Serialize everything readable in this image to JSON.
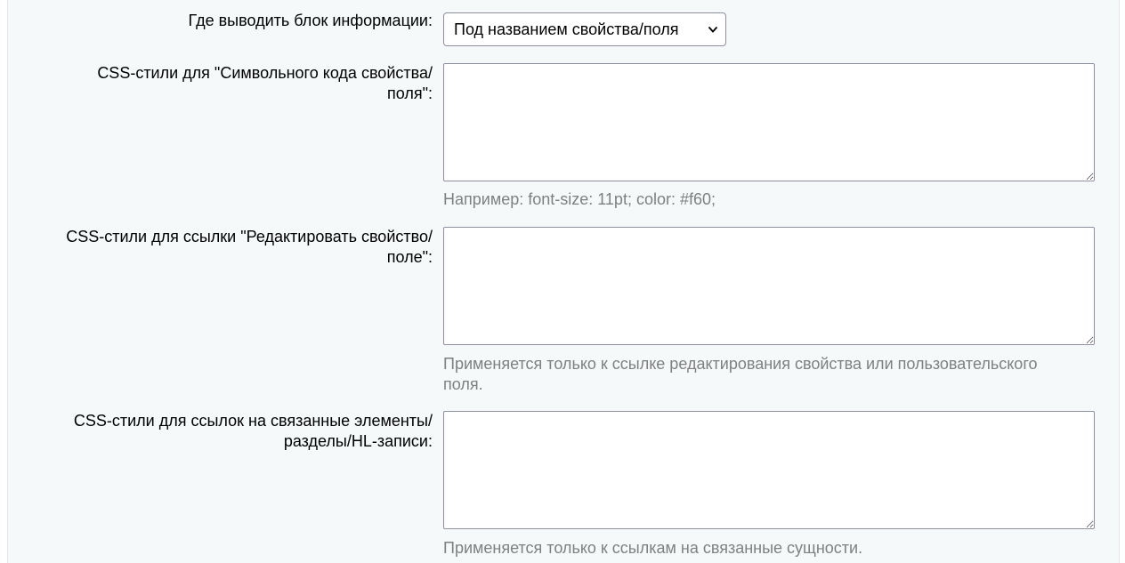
{
  "fields": {
    "info_block": {
      "label": "Где выводить блок информации:",
      "selected": "Под названием свойства/поля"
    },
    "code_css": {
      "label_line1": "CSS-стили для \"Символьного кода свойства/",
      "label_line2": "поля\":",
      "value": "",
      "hint": "Например: font-size: 11pt; color: #f60;"
    },
    "edit_link_css": {
      "label_line1": "CSS-стили для ссылки \"Редактировать свойство/",
      "label_line2": "поле\":",
      "value": "",
      "hint_line1": "Применяется только к ссылке редактирования свойства или пользовательского",
      "hint_line2": "поля."
    },
    "related_css": {
      "label_line1": "CSS-стили для ссылок на связанные элементы/",
      "label_line2": "разделы/HL-записи:",
      "value": "",
      "hint": "Применяется только к ссылкам на связанные сущности."
    }
  },
  "icons": {
    "dropdown": "chevron-down-icon"
  },
  "colors": {
    "panel_bg": "#f5f9f9",
    "hint_text": "#808080",
    "border": "#8f8f9d"
  }
}
